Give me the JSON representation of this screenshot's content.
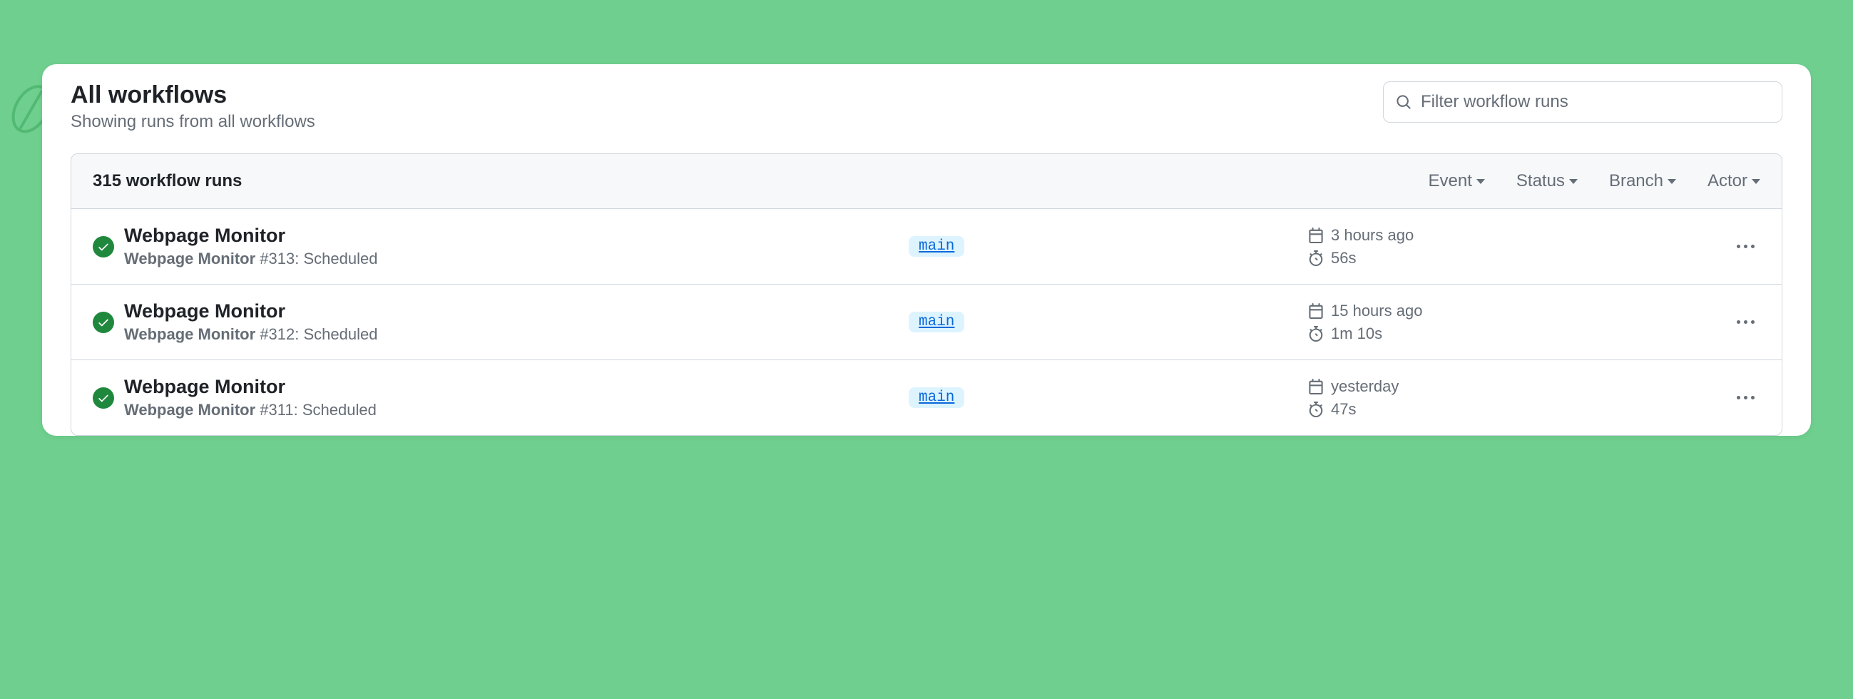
{
  "header": {
    "title": "All workflows",
    "subtitle": "Showing runs from all workflows"
  },
  "search": {
    "placeholder": "Filter workflow runs",
    "value": ""
  },
  "table": {
    "count_label": "315 workflow runs",
    "filters": {
      "event": "Event",
      "status": "Status",
      "branch": "Branch",
      "actor": "Actor"
    }
  },
  "runs": [
    {
      "title": "Webpage Monitor",
      "workflow_name": "Webpage Monitor",
      "run_number": "#313",
      "trigger": "Scheduled",
      "branch": "main",
      "time_ago": "3 hours ago",
      "duration": "56s",
      "status": "success"
    },
    {
      "title": "Webpage Monitor",
      "workflow_name": "Webpage Monitor",
      "run_number": "#312",
      "trigger": "Scheduled",
      "branch": "main",
      "time_ago": "15 hours ago",
      "duration": "1m 10s",
      "status": "success"
    },
    {
      "title": "Webpage Monitor",
      "workflow_name": "Webpage Monitor",
      "run_number": "#311",
      "trigger": "Scheduled",
      "branch": "main",
      "time_ago": "yesterday",
      "duration": "47s",
      "status": "success"
    }
  ]
}
